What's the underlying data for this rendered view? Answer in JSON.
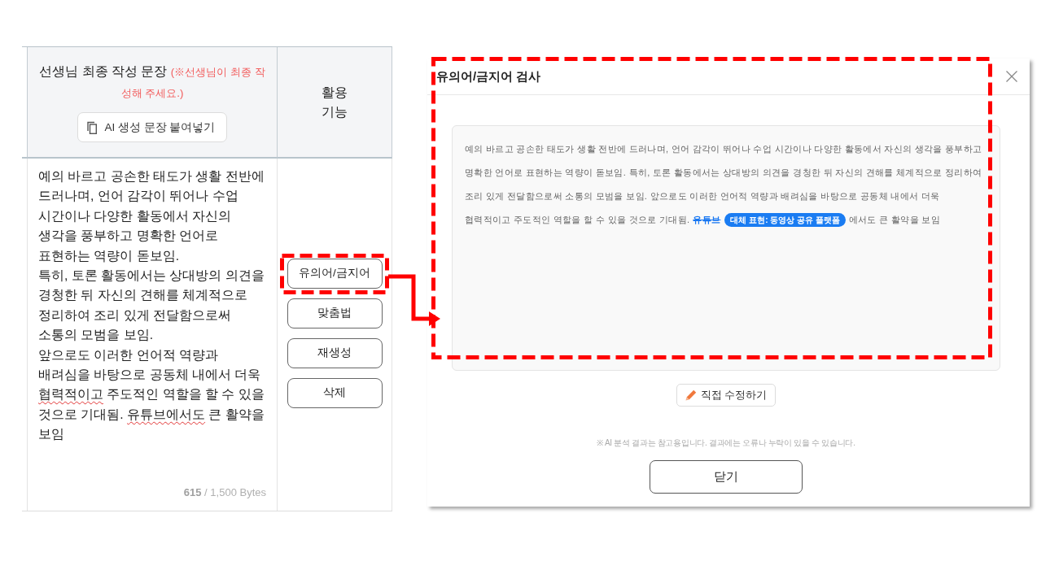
{
  "editor_table": {
    "header": {
      "title": "선생님 최종 작성 문장",
      "note": "(※선생님이 최종 작성해 주세요.)",
      "paste_button": "AI 생성 문장 붙여넣기",
      "tools_heading": "활용 기능"
    },
    "text_field": {
      "segments": [
        {
          "text": "예의 바르고 공손한 태도가 생활 전반에\n드러나며, 언어 감각이 뛰어나 수업\n시간이나 다양한 활동에서 자신의\n생각을 풍부하고 명확한 언어로\n표현하는 역량이 돋보임.\n특히, 토론 활동에서는 상대방의 의견을\n경청한 뒤 자신의 견해를 체계적으로\n정리하여 조리 있게 전달함으로써\n소통의 모범을 보임.\n앞으로도 이러한 언어적 역량과\n배려심을 바탕으로 공동체 내에서 더욱\n",
          "misspelled": false
        },
        {
          "text": "협력적이고",
          "misspelled": true
        },
        {
          "text": " 주도적인 역할을 할 수 있을\n것으로 기대됨. ",
          "misspelled": false
        },
        {
          "text": "유튜브에서도",
          "misspelled": true
        },
        {
          "text": " 큰 활약을\n보임",
          "misspelled": false
        }
      ],
      "byte_count": "**615** / 1,500 Bytes"
    },
    "tool_buttons": [
      {
        "label": "유의어/금지어",
        "highlighted": true
      },
      {
        "label": "맞춤법",
        "highlighted": false
      },
      {
        "label": "재생성",
        "highlighted": false
      },
      {
        "label": "삭제",
        "highlighted": false
      }
    ]
  },
  "dialog": {
    "title": "유의어/금지어 검사",
    "highlighted": true,
    "result_lines": [
      [
        {
          "kind": "text",
          "text": "예의 바르고 공손한 태도가 생활 전반에 드러나며, 언어 감각이 뛰어나 수업 시간이나 다양한 활동에서 자신의 생각을 풍부하고"
        }
      ],
      [
        {
          "kind": "text",
          "text": "명확한 언어로 표현하는 역량이 돋보임. 특히, 토론 활동에서는 상대방의 의견을 경청한 뒤 자신의 견해를 체계적으로 정리하여"
        }
      ],
      [
        {
          "kind": "text",
          "text": "조리 있게 전달함으로써 소통의 모범을 보임. 앞으로도 이러한 언어적 역량과 배려심을 바탕으로 공동체 내에서 더욱"
        }
      ],
      [
        {
          "kind": "text",
          "text": "협력적이고 주도적인 역할을 할 수 있을 것으로 기대됨."
        },
        {
          "kind": "flagged",
          "text": "유튜브"
        },
        {
          "kind": "suggestion",
          "text": "대체 표현: 동영상 공유 플랫폼"
        },
        {
          "kind": "text",
          "text": "에서도 큰 활약을 보임"
        }
      ]
    ],
    "edit_button": "직접 수정하기",
    "notice": "※ AI 분석 결과는 참고용입니다. 결과에는 오류나 누락이 있을 수 있습니다.",
    "close_button": "닫기"
  }
}
